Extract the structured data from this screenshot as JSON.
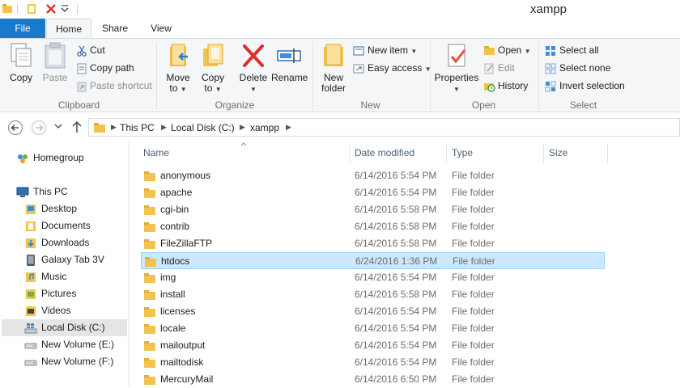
{
  "window": {
    "title": "xampp"
  },
  "tabs": {
    "file": "File",
    "home": "Home",
    "share": "Share",
    "view": "View"
  },
  "ribbon": {
    "clipboard": {
      "label": "Clipboard",
      "copy": "Copy",
      "paste": "Paste",
      "cut": "Cut",
      "copy_path": "Copy path",
      "paste_shortcut": "Paste shortcut"
    },
    "organize": {
      "label": "Organize",
      "move_to_1": "Move",
      "move_to_2": "to",
      "copy_to_1": "Copy",
      "copy_to_2": "to",
      "delete": "Delete",
      "rename": "Rename"
    },
    "new": {
      "label": "New",
      "new_folder_1": "New",
      "new_folder_2": "folder",
      "new_item": "New item",
      "easy_access": "Easy access"
    },
    "open": {
      "label": "Open",
      "properties": "Properties",
      "open": "Open",
      "edit": "Edit",
      "history": "History"
    },
    "select": {
      "label": "Select",
      "select_all": "Select all",
      "select_none": "Select none",
      "invert_selection": "Invert selection"
    }
  },
  "address": {
    "crumbs": [
      "This PC",
      "Local Disk (C:)",
      "xampp"
    ]
  },
  "navpane": {
    "homegroup": "Homegroup",
    "this_pc": "This PC",
    "items": [
      "Desktop",
      "Documents",
      "Downloads",
      "Galaxy Tab 3V",
      "Music",
      "Pictures",
      "Videos",
      "Local Disk (C:)",
      "New Volume (E:)",
      "New Volume (F:)"
    ]
  },
  "columns": {
    "name": "Name",
    "date": "Date modified",
    "type": "Type",
    "size": "Size"
  },
  "files": [
    {
      "name": "anonymous",
      "date": "6/14/2016 5:54 PM",
      "type": "File folder"
    },
    {
      "name": "apache",
      "date": "6/14/2016 5:54 PM",
      "type": "File folder"
    },
    {
      "name": "cgi-bin",
      "date": "6/14/2016 5:58 PM",
      "type": "File folder"
    },
    {
      "name": "contrib",
      "date": "6/14/2016 5:58 PM",
      "type": "File folder"
    },
    {
      "name": "FileZillaFTP",
      "date": "6/14/2016 5:58 PM",
      "type": "File folder"
    },
    {
      "name": "htdocs",
      "date": "6/24/2016 1:36 PM",
      "type": "File folder"
    },
    {
      "name": "img",
      "date": "6/14/2016 5:54 PM",
      "type": "File folder"
    },
    {
      "name": "install",
      "date": "6/14/2016 5:58 PM",
      "type": "File folder"
    },
    {
      "name": "licenses",
      "date": "6/14/2016 5:54 PM",
      "type": "File folder"
    },
    {
      "name": "locale",
      "date": "6/14/2016 5:54 PM",
      "type": "File folder"
    },
    {
      "name": "mailoutput",
      "date": "6/14/2016 5:54 PM",
      "type": "File folder"
    },
    {
      "name": "mailtodisk",
      "date": "6/14/2016 5:54 PM",
      "type": "File folder"
    },
    {
      "name": "MercuryMail",
      "date": "6/14/2016 6:50 PM",
      "type": "File folder"
    }
  ],
  "colors": {
    "accent": "#1979ca",
    "folder": "#f8d775",
    "selection": "#cce8ff"
  }
}
